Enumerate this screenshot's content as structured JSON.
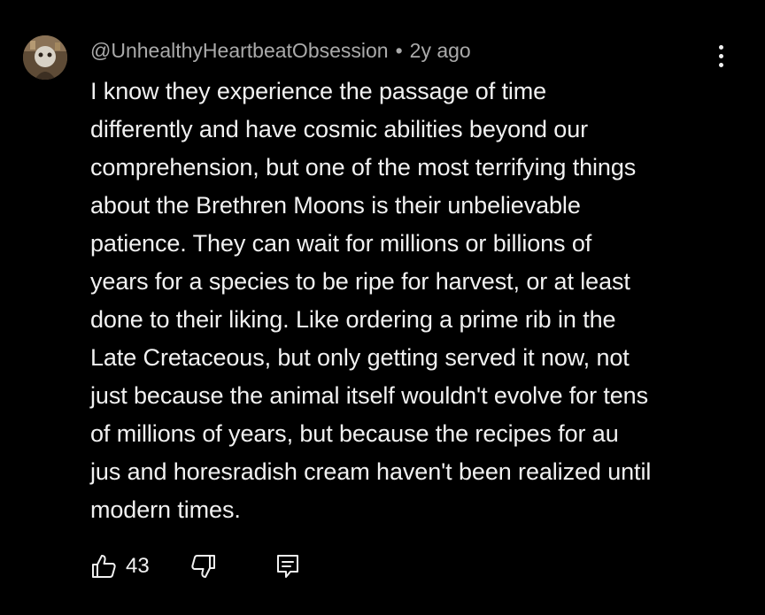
{
  "comment": {
    "author": "@UnhealthyHeartbeatObsession",
    "separator": "•",
    "timestamp": "2y ago",
    "body_lines": [
      "I know they experience the passage of time",
      "differently and have cosmic abilities beyond our",
      "comprehension, but one of the most terrifying things",
      "about the Brethren Moons is their unbelievable",
      "patience. They can wait for millions or billions of",
      "years for a species to be ripe for harvest, or at least",
      "done to their liking. Like ordering a prime rib in the",
      "Late Cretaceous, but only getting served it now, not",
      "just because the animal itself wouldn't evolve for tens",
      "of millions of years, but because the recipes for au",
      "jus and horesradish cream haven't been realized until",
      "modern times."
    ],
    "like_count": "43",
    "icons": {
      "avatar": "avatar-image",
      "menu": "more-vertical-icon",
      "like": "thumbs-up-icon",
      "dislike": "thumbs-down-icon",
      "reply": "reply-comment-icon"
    }
  },
  "colors": {
    "background": "#000000",
    "text_primary": "#f1f1f1",
    "text_secondary": "#aaaaaa"
  }
}
